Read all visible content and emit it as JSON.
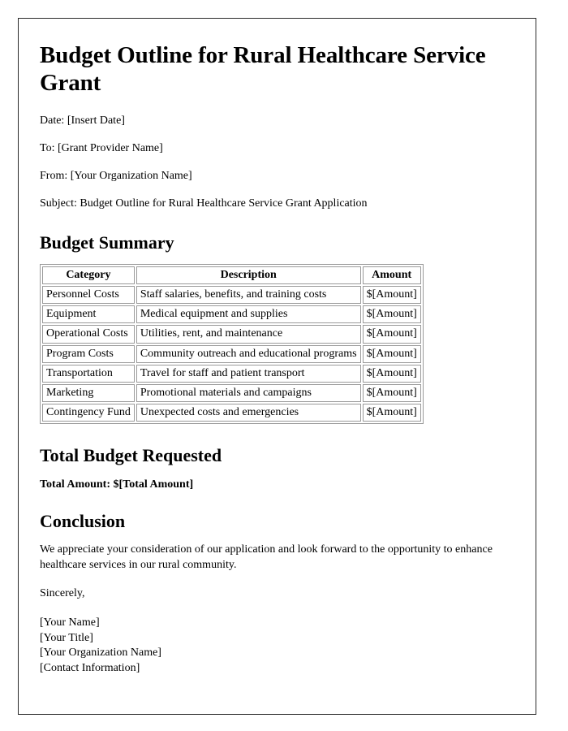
{
  "document": {
    "title": "Budget Outline for Rural Healthcare Service Grant",
    "meta": [
      {
        "label": "Date",
        "text": "Date: [Insert Date]"
      },
      {
        "label": "To",
        "text": "To: [Grant Provider Name]"
      },
      {
        "label": "From",
        "text": "From: [Your Organization Name]"
      },
      {
        "label": "Subject",
        "text": "Subject: Budget Outline for Rural Healthcare Service Grant Application"
      }
    ],
    "sections": {
      "budget_summary": {
        "heading": "Budget Summary",
        "table": {
          "columns": [
            "Category",
            "Description",
            "Amount"
          ],
          "rows": [
            [
              "Personnel Costs",
              "Staff salaries, benefits, and training costs",
              "$[Amount]"
            ],
            [
              "Equipment",
              "Medical equipment and supplies",
              "$[Amount]"
            ],
            [
              "Operational Costs",
              "Utilities, rent, and maintenance",
              "$[Amount]"
            ],
            [
              "Program Costs",
              "Community outreach and educational programs",
              "$[Amount]"
            ],
            [
              "Transportation",
              "Travel for staff and patient transport",
              "$[Amount]"
            ],
            [
              "Marketing",
              "Promotional materials and campaigns",
              "$[Amount]"
            ],
            [
              "Contingency Fund",
              "Unexpected costs and emergencies",
              "$[Amount]"
            ]
          ]
        }
      },
      "total_budget": {
        "heading": "Total Budget Requested",
        "total_line": "Total Amount: $[Total Amount]"
      },
      "conclusion": {
        "heading": "Conclusion",
        "paragraph": "We appreciate your consideration of our application and look forward to the opportunity to enhance healthcare services in our rural community.",
        "closing": "Sincerely,",
        "signature": [
          "[Your Name]",
          "[Your Title]",
          "[Your Organization Name]",
          "[Contact Information]"
        ]
      }
    }
  },
  "style": {
    "page_border_color": "#2a2a2a",
    "table_border_color": "#9a9a9a",
    "text_color": "#000000",
    "background_color": "#ffffff"
  }
}
